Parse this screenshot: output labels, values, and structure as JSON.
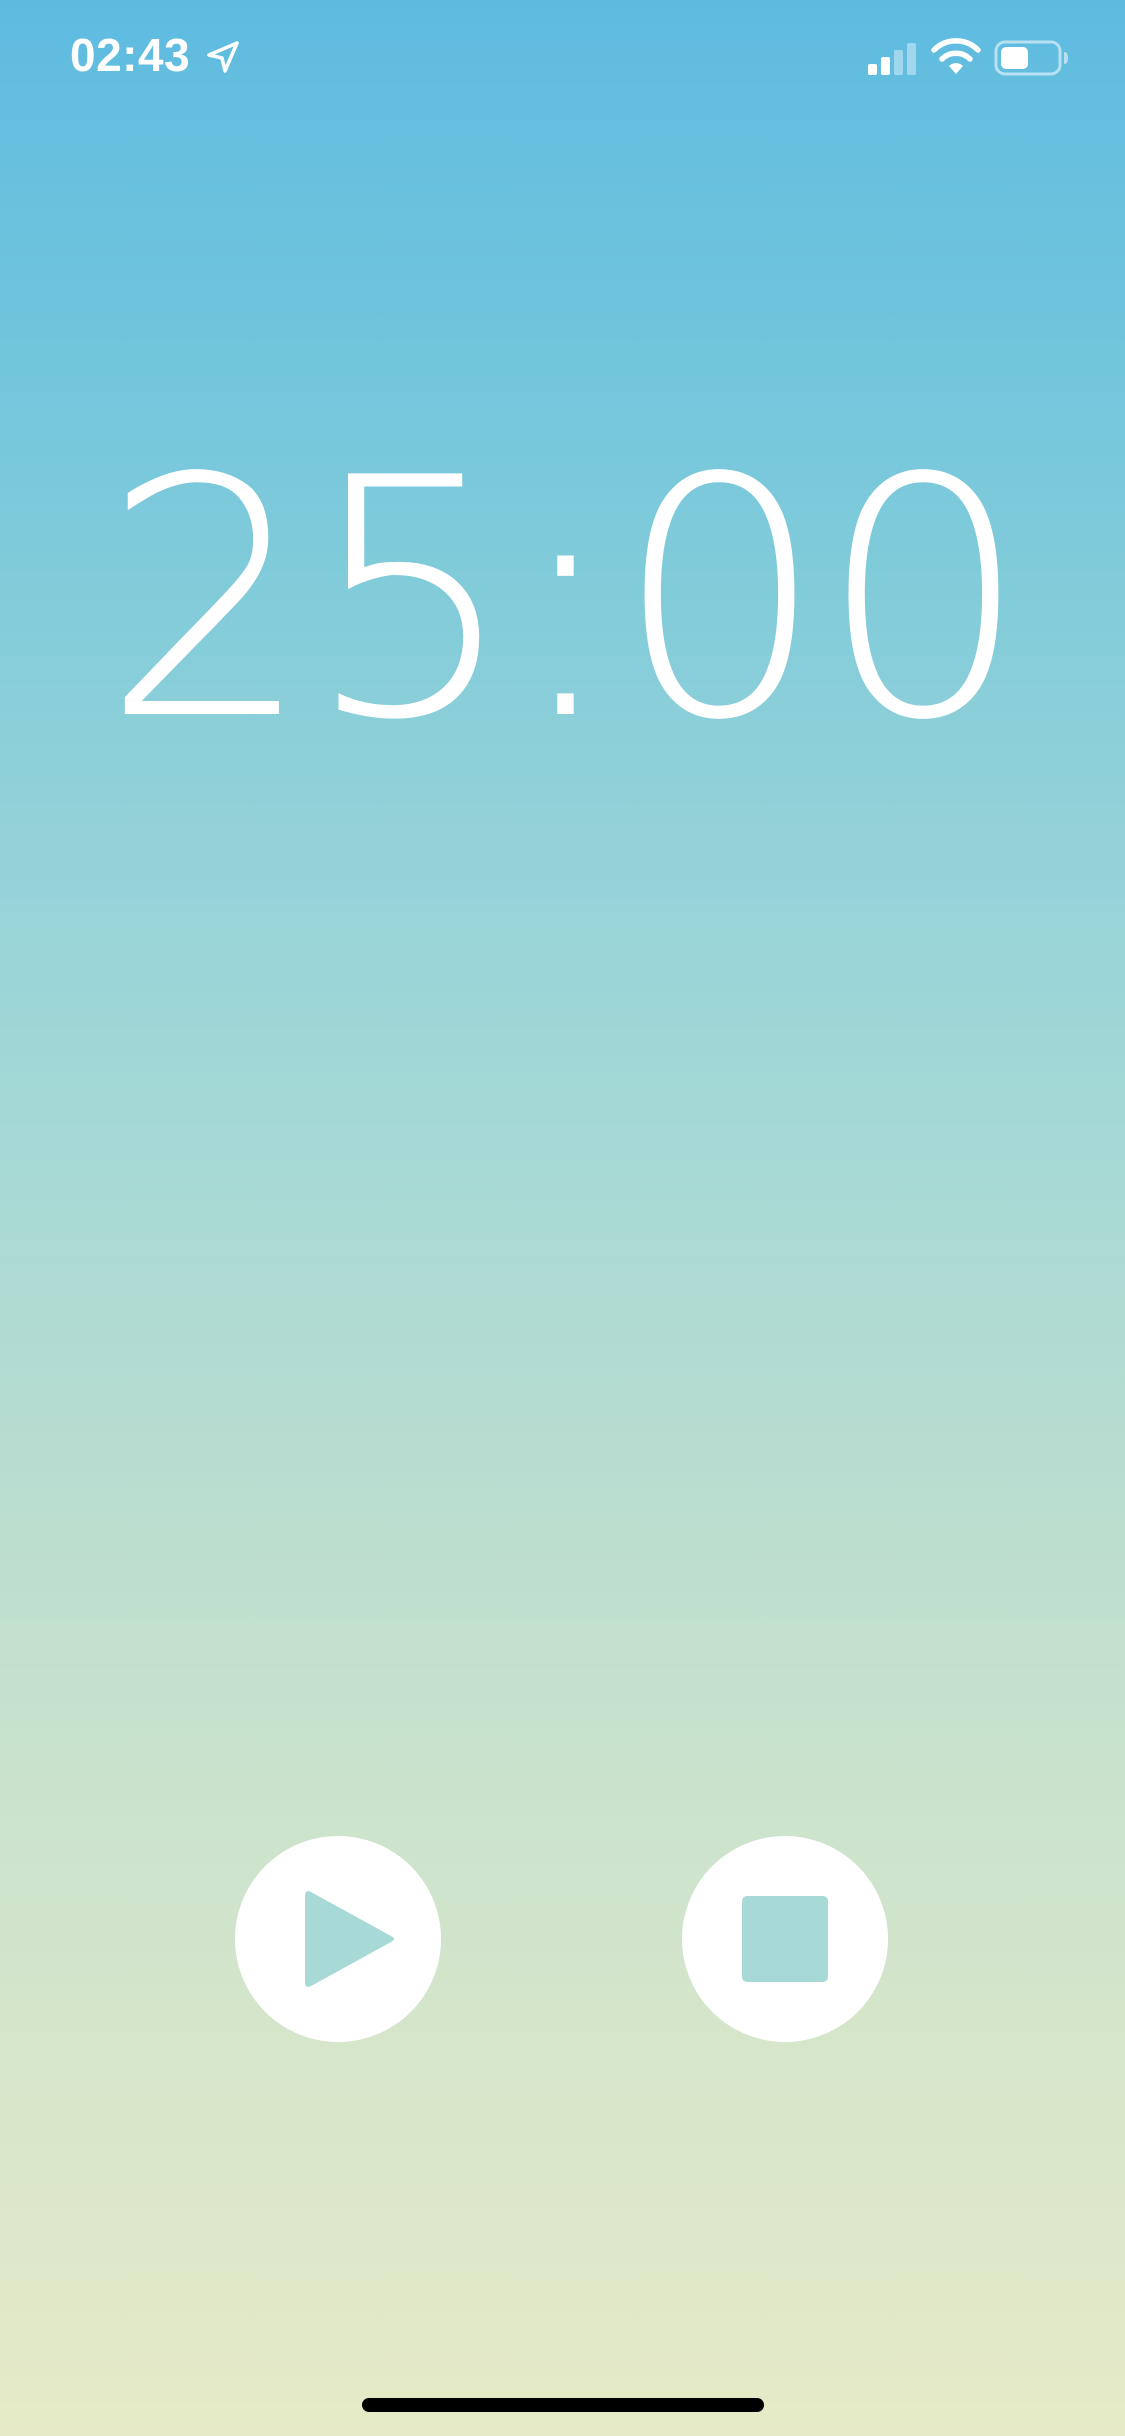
{
  "status_bar": {
    "time": "02:43",
    "location_icon": "location-arrow-icon",
    "signal_icon": "cellular-signal-icon",
    "signal_bars_active": 2,
    "signal_bars_total": 4,
    "wifi_icon": "wifi-icon",
    "battery_icon": "battery-icon",
    "battery_level": 0.5
  },
  "timer": {
    "display": "25:00"
  },
  "controls": {
    "play_icon": "play-icon",
    "stop_icon": "stop-icon"
  },
  "colors": {
    "gradient_top": "#5ebbe0",
    "gradient_bottom": "#e6eac7",
    "foreground": "#ffffff",
    "button_icon": "#a7d9d6"
  }
}
